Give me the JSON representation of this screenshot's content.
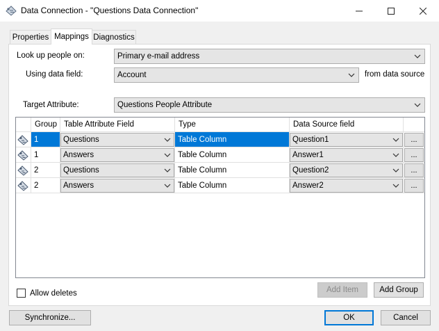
{
  "window": {
    "title": "Data Connection - \"Questions Data Connection\"",
    "minimize_glyph": "─",
    "maximize_glyph": "☐",
    "close_glyph": "✕"
  },
  "tabs": [
    {
      "label": "Properties",
      "active": false
    },
    {
      "label": "Mappings",
      "active": true
    },
    {
      "label": "Diagnostics",
      "active": false
    }
  ],
  "form": {
    "lookup_label": "Look up people on:",
    "lookup_value": "Primary e-mail address",
    "using_label": "Using data field:",
    "using_value": "Account",
    "from_source_label": "from data source",
    "target_label": "Target Attribute:",
    "target_value": "Questions People Attribute"
  },
  "grid": {
    "headers": {
      "group": "Group",
      "field": "Table Attribute Field",
      "type": "Type",
      "source": "Data Source field"
    },
    "ellipsis": "...",
    "rows": [
      {
        "group": "1",
        "field": "Questions",
        "type": "Table Column",
        "source": "Question1",
        "selected": true
      },
      {
        "group": "1",
        "field": "Answers",
        "type": "Table Column",
        "source": "Answer1",
        "selected": false
      },
      {
        "group": "2",
        "field": "Questions",
        "type": "Table Column",
        "source": "Question2",
        "selected": false
      },
      {
        "group": "2",
        "field": "Answers",
        "type": "Table Column",
        "source": "Answer2",
        "selected": false
      }
    ]
  },
  "options": {
    "allow_deletes_label": "Allow deletes",
    "allow_deletes_checked": false
  },
  "buttons": {
    "add_item": "Add Item",
    "add_group": "Add Group",
    "synchronize": "Synchronize...",
    "ok": "OK",
    "cancel": "Cancel"
  },
  "colors": {
    "selection": "#0078d7",
    "window_bg": "#f0f0f0"
  }
}
